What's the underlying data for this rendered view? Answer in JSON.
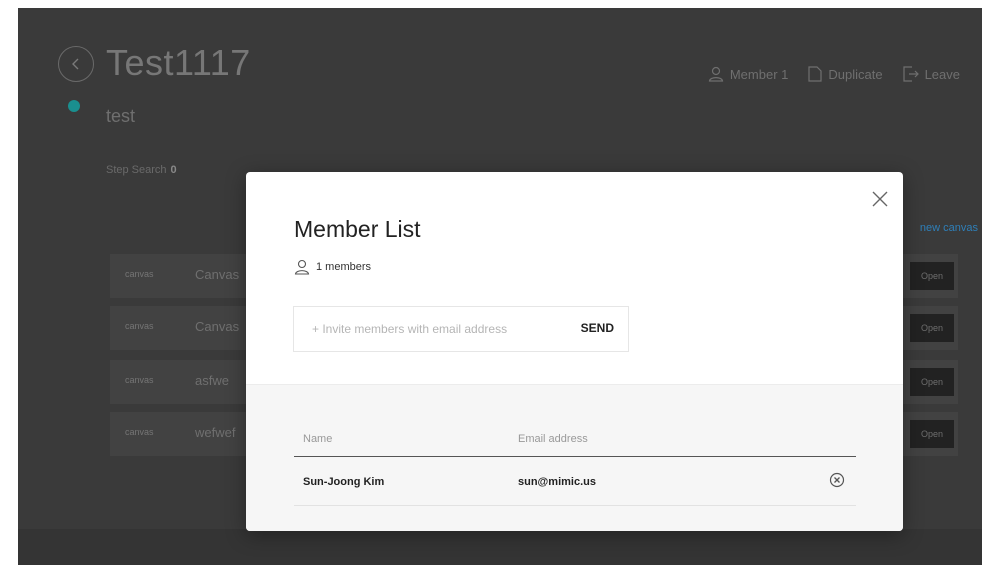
{
  "background": {
    "title": "Test1117",
    "subtitle": "test",
    "header_actions": {
      "member": "Member 1",
      "duplicate": "Duplicate",
      "leave": "Leave"
    },
    "stats": {
      "step_search_label": "Step Search",
      "step_search_value": "0"
    },
    "new_canvas": "new canvas",
    "canvas_rows": [
      {
        "tag": "canvas",
        "name": "Canvas",
        "open": "Open"
      },
      {
        "tag": "canvas",
        "name": "Canvas",
        "open": "Open"
      },
      {
        "tag": "canvas",
        "name": "asfwe",
        "open": "Open"
      },
      {
        "tag": "canvas",
        "name": "wefwef",
        "open": "Open"
      }
    ]
  },
  "modal": {
    "title": "Member List",
    "member_count": "1 members",
    "invite": {
      "placeholder": "+ Invite members with email address",
      "send_label": "SEND"
    },
    "table": {
      "headers": {
        "name": "Name",
        "email": "Email address"
      },
      "rows": [
        {
          "name": "Sun-Joong Kim",
          "email": "sun@mimic.us"
        }
      ]
    }
  },
  "icons": {
    "back": "chevron-left-icon",
    "member": "user-icon",
    "duplicate": "document-icon",
    "leave": "exit-icon",
    "close": "close-icon",
    "remove": "remove-circle-icon"
  },
  "colors": {
    "overlay_bg": "#3a3a3a",
    "status_dot": "#1a8f8f",
    "link": "#2f7fb8"
  }
}
